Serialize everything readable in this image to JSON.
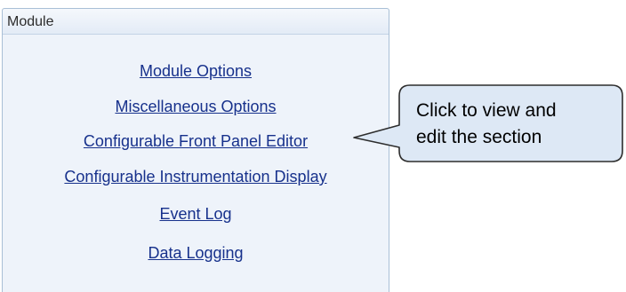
{
  "panel": {
    "title": "Module",
    "links": [
      {
        "label": "Module Options"
      },
      {
        "label": "Miscellaneous Options"
      },
      {
        "label": "Configurable Front Panel Editor"
      },
      {
        "label": "Configurable Instrumentation Display"
      },
      {
        "label": "Event Log"
      },
      {
        "label": "Data Logging"
      }
    ]
  },
  "callout": {
    "line1": "Click to view and",
    "line2": "edit the section"
  },
  "colors": {
    "panel_background": "#eef3fa",
    "panel_border": "#a9bfd6",
    "link": "#17318c",
    "callout_fill": "#dde8f5",
    "callout_border": "#2d2d2d"
  }
}
